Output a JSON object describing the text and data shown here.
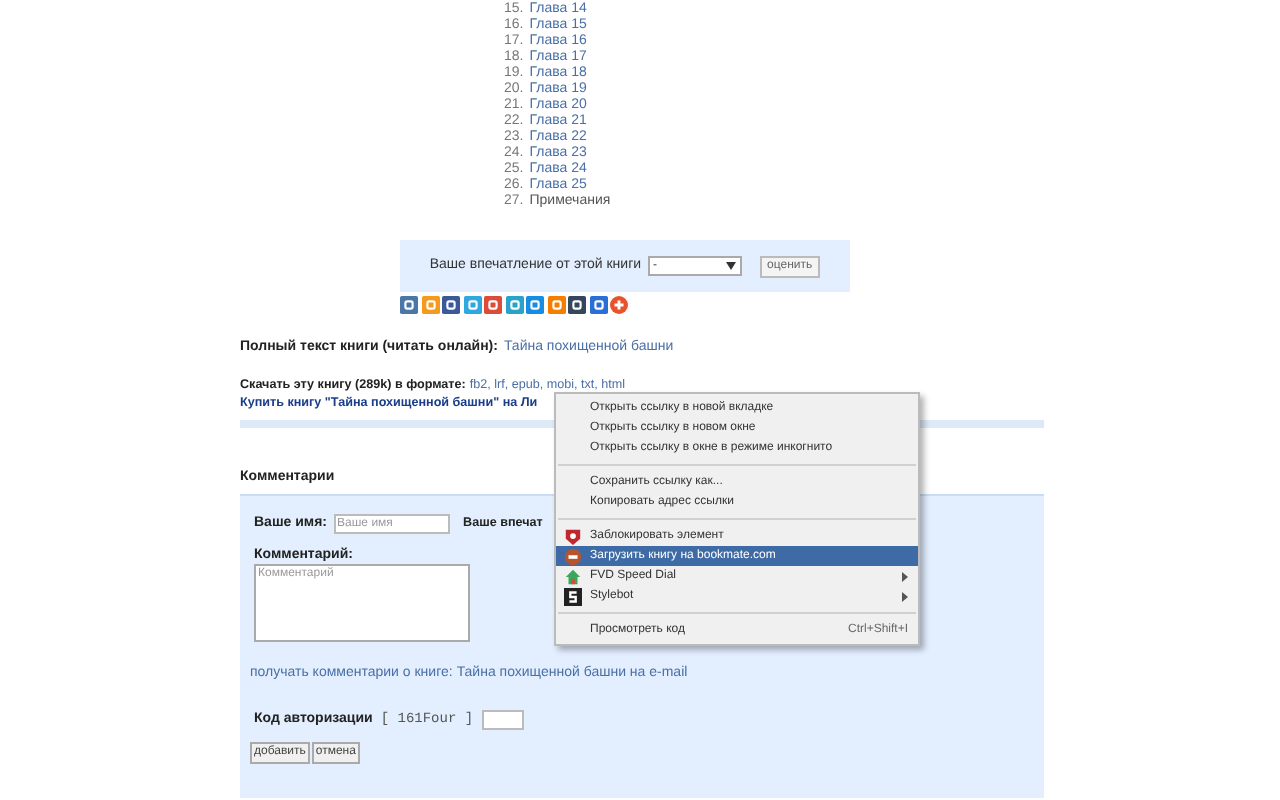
{
  "chapters": [
    {
      "number": "15.",
      "title": "Глава 14"
    },
    {
      "number": "16.",
      "title": "Глава 15"
    },
    {
      "number": "17.",
      "title": "Глава 16"
    },
    {
      "number": "18.",
      "title": "Глава 17"
    },
    {
      "number": "19.",
      "title": "Глава 18"
    },
    {
      "number": "20.",
      "title": "Глава 19"
    },
    {
      "number": "21.",
      "title": "Глава 20"
    },
    {
      "number": "22.",
      "title": "Глава 21"
    },
    {
      "number": "23.",
      "title": "Глава 22"
    },
    {
      "number": "24.",
      "title": "Глава 23"
    },
    {
      "number": "25.",
      "title": "Глава 24"
    },
    {
      "number": "26.",
      "title": "Глава 25"
    },
    {
      "number": "27.",
      "title": "Примечания",
      "kind": "text"
    }
  ],
  "rating": {
    "label": "Ваше впечатление от этой книги",
    "select_value": "-",
    "button": "оценить"
  },
  "share_buttons": [
    {
      "color": "#4a76a8"
    },
    {
      "color": "#f59a1e"
    },
    {
      "color": "#3b5998"
    },
    {
      "color": "#2fa8e0"
    },
    {
      "color": "#dd4b39"
    },
    {
      "color": "#2aa3c9"
    },
    {
      "color": "#168de2"
    },
    {
      "color": "#f57d00"
    },
    {
      "color": "#36465d"
    },
    {
      "color": "#2a6fd6"
    },
    {
      "color": "#e8532d",
      "round": true
    }
  ],
  "read_online": {
    "label": "Полный текст книги (читать онлайн):",
    "link": "Тайна похищенной башни"
  },
  "download": {
    "label": "Скачать эту книгу (289k) в формате:",
    "formats": "fb2, lrf, epub, mobi, txt, html"
  },
  "buy": {
    "text": "Купить книгу \"Тайна похищенной башни\" на Ли"
  },
  "comments": {
    "heading": "Комментарии",
    "name_label": "Ваше имя:",
    "name_placeholder": "Ваше имя",
    "impression_label": "Ваше впечат",
    "comment_label": "Комментарий:",
    "comment_placeholder": "Комментарий",
    "subscribe_prefix": "получать комментарии о книге:",
    "subscribe_link": "Тайна похищенной башни на e-mail",
    "auth_label": "Код авторизации",
    "auth_code": "[ 161Four ]",
    "buttons": [
      "добавить",
      "отмена"
    ]
  },
  "context_menu": [
    {
      "kind": "item",
      "label": "Открыть ссылку в новой вкладке",
      "selected": false
    },
    {
      "kind": "item",
      "label": "Открыть ссылку в новом окне",
      "selected": false
    },
    {
      "kind": "item",
      "label": "Открыть ссылку в окне в режиме инкогнито",
      "selected": false
    },
    {
      "kind": "separator"
    },
    {
      "kind": "item",
      "label": "Сохранить ссылку как...",
      "selected": false
    },
    {
      "kind": "item",
      "label": "Копировать адрес ссылки",
      "selected": false
    },
    {
      "kind": "separator"
    },
    {
      "kind": "item",
      "label": "Заблокировать элемент",
      "selected": false
    },
    {
      "kind": "item",
      "label": "Загрузить книгу на bookmate.com",
      "selected": true
    },
    {
      "kind": "item",
      "label": "FVD Speed Dial",
      "submenu": true,
      "selected": false
    },
    {
      "kind": "item",
      "label": "Stylebot",
      "submenu": true,
      "selected": false
    },
    {
      "kind": "separator"
    },
    {
      "kind": "item",
      "label": "Просмотреть код",
      "shortcut": "Ctrl+Shift+I",
      "selected": false
    }
  ]
}
